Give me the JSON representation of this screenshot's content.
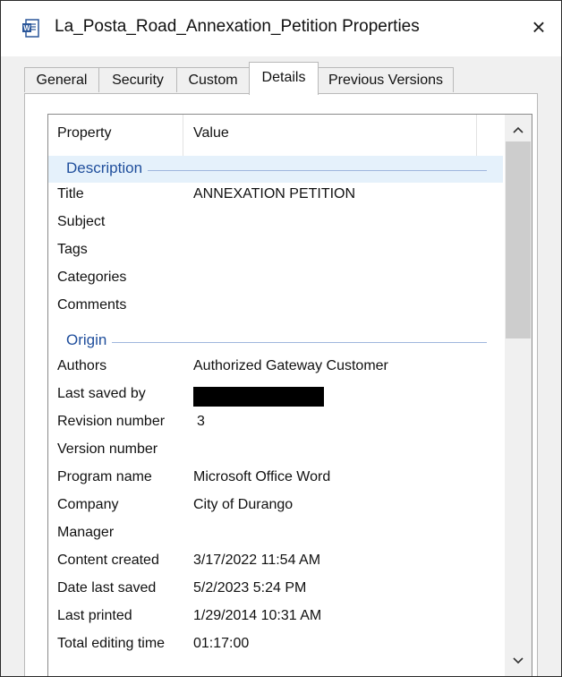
{
  "window": {
    "title": "La_Posta_Road_Annexation_Petition Properties",
    "close_label": "×",
    "app_icon": "word-document-icon"
  },
  "tabs": [
    {
      "label": "General",
      "selected": false
    },
    {
      "label": "Security",
      "selected": false
    },
    {
      "label": "Custom",
      "selected": false
    },
    {
      "label": "Details",
      "selected": true
    },
    {
      "label": "Previous Versions",
      "selected": false
    }
  ],
  "details": {
    "columns": {
      "property": "Property",
      "value": "Value"
    },
    "groups": [
      {
        "name": "Description",
        "rows": [
          {
            "property": "Title",
            "value": "ANNEXATION  PETITION"
          },
          {
            "property": "Subject",
            "value": ""
          },
          {
            "property": "Tags",
            "value": ""
          },
          {
            "property": "Categories",
            "value": ""
          },
          {
            "property": "Comments",
            "value": ""
          }
        ]
      },
      {
        "name": "Origin",
        "rows": [
          {
            "property": "Authors",
            "value": "Authorized Gateway Customer"
          },
          {
            "property": "Last saved by",
            "value": "",
            "redacted": true
          },
          {
            "property": "Revision number",
            "value": "3"
          },
          {
            "property": "Version number",
            "value": ""
          },
          {
            "property": "Program name",
            "value": "Microsoft Office Word"
          },
          {
            "property": "Company",
            "value": "City of Durango"
          },
          {
            "property": "Manager",
            "value": ""
          },
          {
            "property": "Content created",
            "value": "3/17/2022 11:54 AM"
          },
          {
            "property": "Date last saved",
            "value": "5/2/2023 5:24 PM"
          },
          {
            "property": "Last printed",
            "value": "1/29/2014 10:31 AM"
          },
          {
            "property": "Total editing time",
            "value": "01:17:00"
          }
        ]
      }
    ]
  },
  "scrollbar": {
    "up_icon": "chevron-up-icon",
    "down_icon": "chevron-down-icon"
  },
  "colors": {
    "group_header_text": "#1f4e9c",
    "group_highlight": "#e5f1fb",
    "dialog_background": "#f0f0f0"
  }
}
